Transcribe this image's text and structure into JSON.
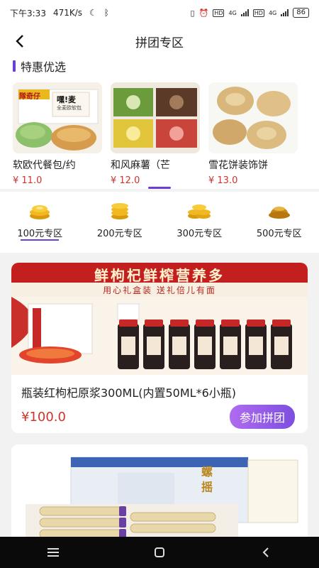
{
  "status_bar": {
    "time": "下午3:33",
    "network_speed": "471K/s",
    "hd1": "HD",
    "net1": "4G",
    "hd2": "HD",
    "net2": "4G",
    "battery": "86"
  },
  "nav": {
    "title": "拼团专区",
    "back_icon": "chevron-left-icon"
  },
  "special": {
    "title": "特惠优选",
    "accent_color": "#6b3fd6",
    "items": [
      {
        "name": "软欧代餐包/约",
        "price": "¥ 11.0",
        "brand_text": "隊奇仔",
        "badge_text": "嘿!麦",
        "badge_sub": "全麦欧软包"
      },
      {
        "name": "和风麻薯（芒",
        "price": "¥ 12.0"
      },
      {
        "name": "雪花饼装饰饼",
        "price": "¥ 13.0"
      }
    ]
  },
  "tiers": [
    {
      "label": "100元专区",
      "icon": "coin-stack-icon",
      "selected": true
    },
    {
      "label": "200元专区",
      "icon": "coin-stack-icon",
      "selected": false
    },
    {
      "label": "300元专区",
      "icon": "coin-stack-icon",
      "selected": false
    },
    {
      "label": "500元专区",
      "icon": "coin-stack-icon",
      "selected": false
    }
  ],
  "products": [
    {
      "banner_headline": "鲜枸杞鲜榨营养多",
      "banner_sub": "用心礼盒装 送礼倍儿有面",
      "name": "瓶装红枸杞原浆300ML(内置50ML*6小瓶)",
      "price": "¥100.0",
      "button": "参加拼团"
    },
    {
      "box_text": "螺 摇"
    }
  ],
  "colors": {
    "price": "#d0342c",
    "accent": "#6b3fd6",
    "button_gradient": [
      "#b06bf0",
      "#7c4fe0"
    ]
  },
  "sys_nav": {
    "menu_icon": "menu-icon",
    "home_icon": "home-square-icon",
    "back_icon": "back-triangle-icon"
  }
}
